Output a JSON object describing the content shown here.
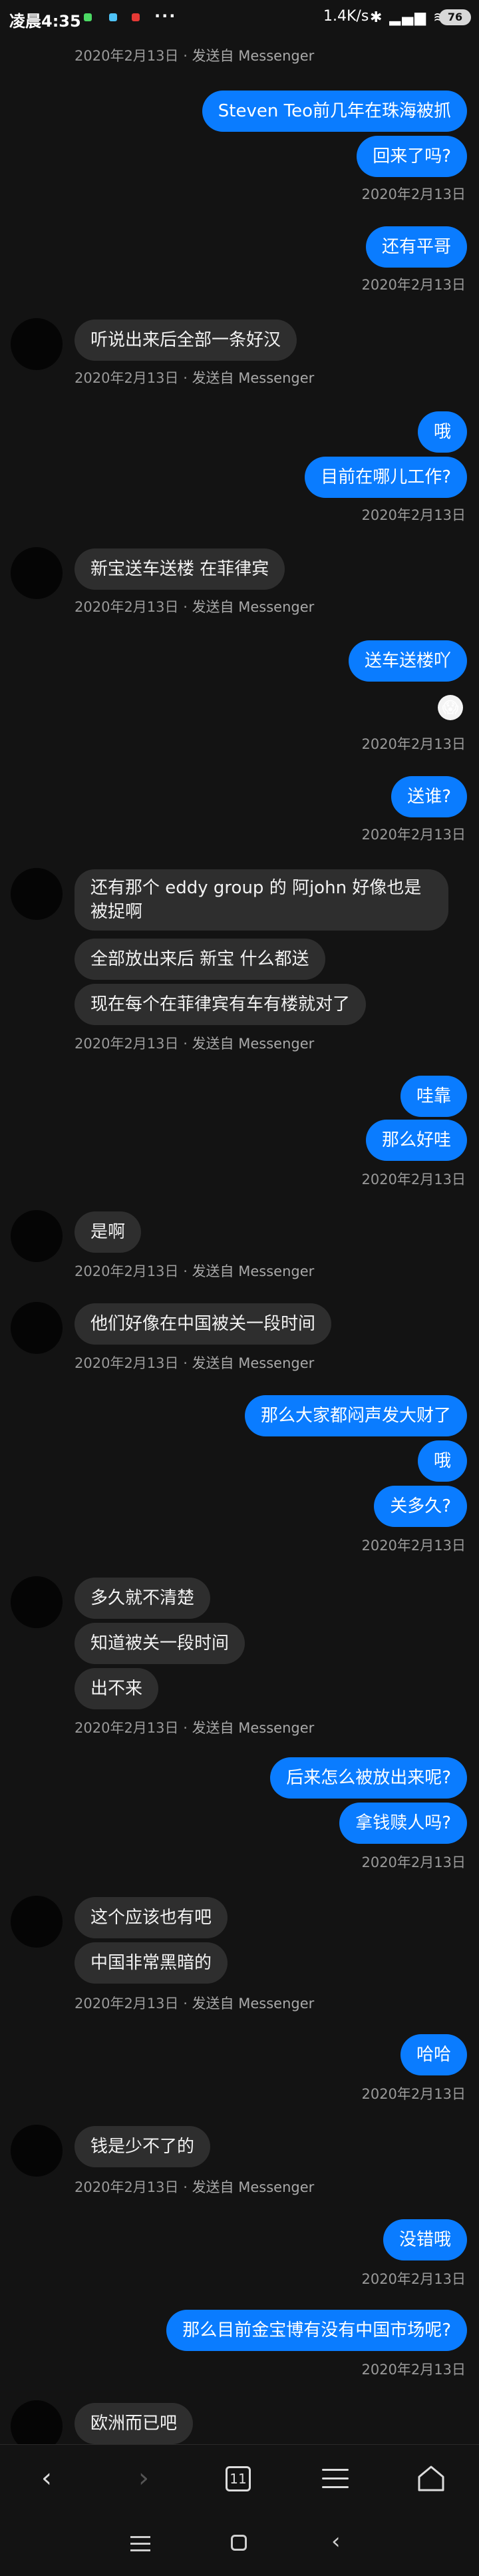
{
  "status_bar": {
    "time": "凌晨4:35",
    "more": "···",
    "net_speed": "1.4K/s",
    "icons": "✱ ▂▄▆ ≋",
    "battery": "76",
    "dot_colors": [
      "#4cd964",
      "#4fc3f7",
      "#e53935"
    ]
  },
  "colors": {
    "outgoing": "#0a7cff",
    "incoming": "#2e2e2e",
    "background": "#131313"
  },
  "meta_via": "发送自 Messenger",
  "chat": {
    "m0_meta_date": "2020年2月13日",
    "m1_text": "Steven Teo前几年在珠海被抓",
    "m2_text": "回来了吗?",
    "m2_meta": "2020年2月13日",
    "m3_text": "还有平哥",
    "m3_meta": "2020年2月13日",
    "m4_text": "听说出来后全部一条好汉",
    "m4_meta_date": "2020年2月13日",
    "m5_text": "哦",
    "m6_text": "目前在哪儿工作?",
    "m6_meta": "2020年2月13日",
    "m7_text": "新宝送车送楼 在菲律宾",
    "m7_meta_date": "2020年2月13日",
    "m8_text": "送车送楼吖",
    "m8_reaction": "😱",
    "m8_meta": "2020年2月13日",
    "m9_text": "送谁?",
    "m9_meta": "2020年2月13日",
    "m10_text": "还有那个 eddy group 的 阿john 好像也是被捉啊",
    "m11_text": "全部放出来后 新宝 什么都送",
    "m12_text": "现在每个在菲律宾有车有楼就对了",
    "m12_meta_date": "2020年2月13日",
    "m13_text": "哇靠",
    "m14_text": "那么好哇",
    "m14_meta": "2020年2月13日",
    "m15_text": "是啊",
    "m15_meta_date": "2020年2月13日",
    "m16_text": "他们好像在中国被关一段时间",
    "m16_meta_date": "2020年2月13日",
    "m17_text": "那么大家都闷声发大财了",
    "m18_text": "哦",
    "m19_text": "关多久?",
    "m19_meta": "2020年2月13日",
    "m20_text": "多久就不清楚",
    "m21_text": "知道被关一段时间",
    "m22_text": "出不来",
    "m22_meta_date": "2020年2月13日",
    "m23_text": "后来怎么被放出来呢?",
    "m24_text": "拿钱赎人吗?",
    "m24_meta": "2020年2月13日",
    "m25_text": "这个应该也有吧",
    "m26_text": "中国非常黑暗的",
    "m26_meta_date": "2020年2月13日",
    "m27_text": "哈哈",
    "m27_meta": "2020年2月13日",
    "m28_text": "钱是少不了的",
    "m28_meta_date": "2020年2月13日",
    "m29_text": "没错哦",
    "m29_meta": "2020年2月13日",
    "m30_text": "那么目前金宝博有没有中国市场呢?",
    "m30_meta": "2020年2月13日",
    "m31_text": "欧洲而已吧"
  },
  "toolbar": {
    "back": "‹",
    "forward": "›",
    "tab_count": "11"
  },
  "navbar": {
    "back": "‹"
  }
}
